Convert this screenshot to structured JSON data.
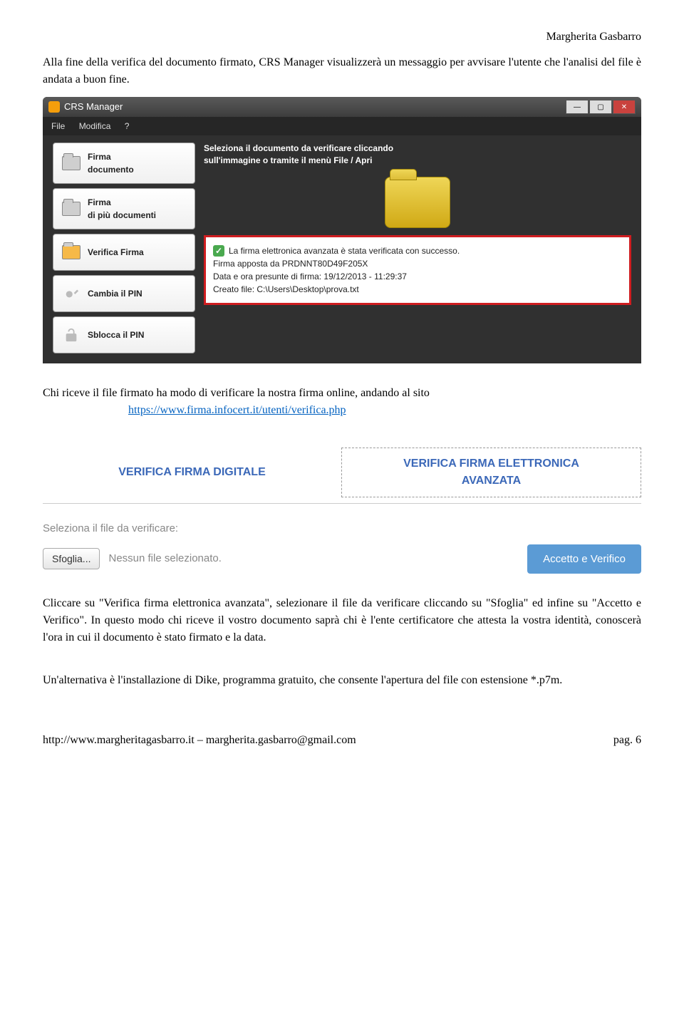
{
  "header_name": "Margherita Gasbarro",
  "paragraph1": "Alla fine della verifica del documento firmato, CRS Manager visualizzerà un messaggio per avvisare l'utente che l'analisi del file è andata a buon fine.",
  "app": {
    "title": "CRS Manager",
    "menu": {
      "file": "File",
      "modifica": "Modifica",
      "help": "?"
    },
    "sidebar": {
      "firma_doc_l1": "Firma",
      "firma_doc_l2": "documento",
      "firma_piu_l1": "Firma",
      "firma_piu_l2": "di più documenti",
      "verifica": "Verifica Firma",
      "cambia_pin": "Cambia il PIN",
      "sblocca_pin": "Sblocca il PIN"
    },
    "hint_l1": "Seleziona il documento da verificare cliccando",
    "hint_l2": "sull'immagine o tramite il menù File / Apri",
    "verify": {
      "success": "La firma elettronica avanzata è stata verificata con successo.",
      "signed_by_label": "Firma apposta da ",
      "signed_by_value": "PRDNNT80D49F205X",
      "datetime": "Data e ora presunte di firma: 19/12/2013 - 11:29:37",
      "file": "Creato file: C:\\Users\\Desktop\\prova.txt"
    }
  },
  "paragraph2_pre": "Chi riceve il file firmato ha modo di verificare la nostra firma online, andando al sito",
  "link_url": "https://www.firma.infocert.it/utenti/verifica.php",
  "tabs": {
    "digital": "VERIFICA FIRMA DIGITALE",
    "avanzata_l1": "VERIFICA FIRMA ELETTRONICA",
    "avanzata_l2": "AVANZATA"
  },
  "fileselect": {
    "label": "Seleziona il file da verificare:",
    "browse": "Sfoglia...",
    "none": "Nessun file selezionato.",
    "accept": "Accetto e Verifico"
  },
  "paragraph3": "Cliccare su \"Verifica firma elettronica avanzata\", selezionare il file da verificare cliccando su \"Sfoglia\" ed infine su \"Accetto e Verifico\". In questo modo chi riceve il vostro documento saprà chi è l'ente certificatore che attesta la vostra identità, conoscerà l'ora in cui il documento è stato firmato e la data.",
  "paragraph4": "Un'alternativa è l'installazione di Dike, programma gratuito, che consente l'apertura del file con estensione *.p7m.",
  "footer": {
    "left": "http://www.margheritagasbarro.it – margherita.gasbarro@gmail.com",
    "right": "pag. 6"
  }
}
